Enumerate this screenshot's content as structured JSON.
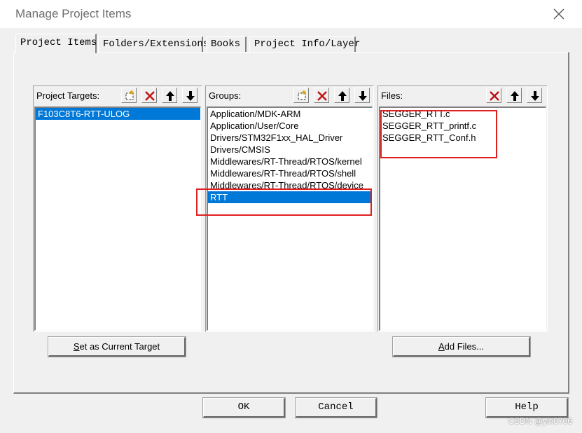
{
  "window": {
    "title": "Manage Project Items"
  },
  "tabs": [
    {
      "label": "Project Items",
      "active": true
    },
    {
      "label": "Folders/Extensions",
      "active": false
    },
    {
      "label": "Books",
      "active": false
    },
    {
      "label": "Project Info/Layer",
      "active": false
    }
  ],
  "targets": {
    "header": "Project Targets:",
    "items": [
      "F103C8T6-RTT-ULOG"
    ],
    "selected_index": 0,
    "button_prefix": "S",
    "button_rest": "et as Current Target"
  },
  "groups": {
    "header": "Groups:",
    "items": [
      "Application/MDK-ARM",
      "Application/User/Core",
      "Drivers/STM32F1xx_HAL_Driver",
      "Drivers/CMSIS",
      "Middlewares/RT-Thread/RTOS/kernel",
      "Middlewares/RT-Thread/RTOS/shell",
      "Middlewares/RT-Thread/RTOS/device",
      "RTT"
    ],
    "selected_index": 7
  },
  "files": {
    "header": "Files:",
    "items": [
      "SEGGER_RTT.c",
      "SEGGER_RTT_printf.c",
      "SEGGER_RTT_Conf.h"
    ],
    "button_prefix": "A",
    "button_rest": "dd Files..."
  },
  "footer": {
    "ok": "OK",
    "cancel": "Cancel",
    "help": "Help"
  },
  "watermark": "CSDN @yin0706",
  "colors": {
    "selection": "#0078d7",
    "highlight_box": "#e02020"
  }
}
